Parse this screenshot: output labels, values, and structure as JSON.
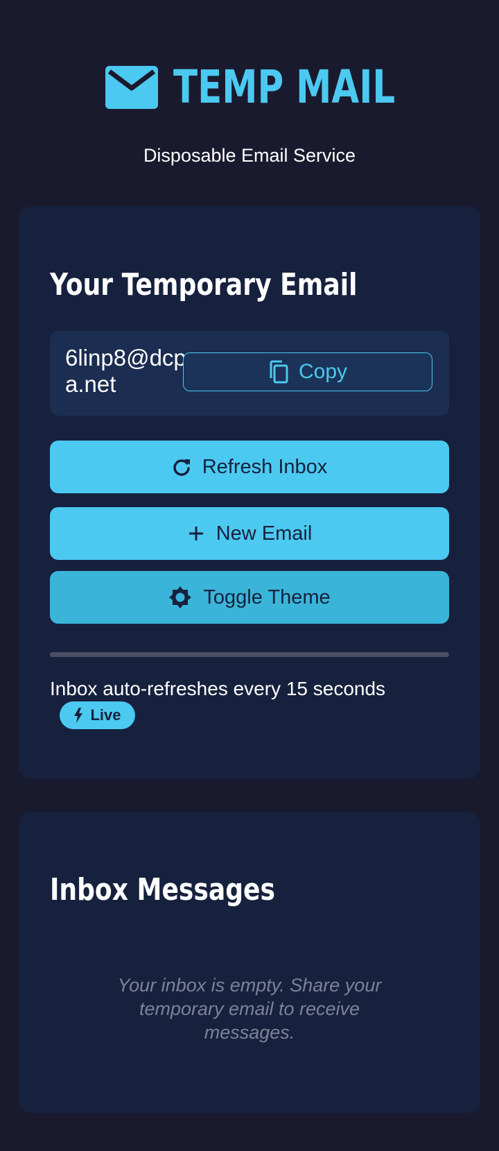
{
  "header": {
    "title": "TEMP MAIL",
    "subtitle": "Disposable Email Service",
    "logo_icon": "envelope-icon"
  },
  "email_card": {
    "heading": "Your Temporary Email",
    "email_address": "6linp8@dcpa.net",
    "copy_label": "Copy",
    "copy_icon": "copy-icon",
    "refresh_label": "Refresh Inbox",
    "refresh_icon": "refresh-icon",
    "new_email_label": "New Email",
    "new_email_icon": "plus-icon",
    "toggle_theme_label": "Toggle Theme",
    "toggle_theme_icon": "brightness-icon",
    "auto_refresh_text": "Inbox auto-refreshes every 15 seconds",
    "live_badge_label": "Live",
    "live_badge_icon": "bolt-icon"
  },
  "inbox_card": {
    "heading": "Inbox Messages",
    "empty_message": "Your inbox is empty. Share your temporary email to receive messages."
  },
  "colors": {
    "background": "#1a1a2e",
    "card": "#16213e",
    "accent": "#4cc9f0",
    "accent_dark": "#3ab5d9",
    "muted_text": "#7d8296"
  }
}
